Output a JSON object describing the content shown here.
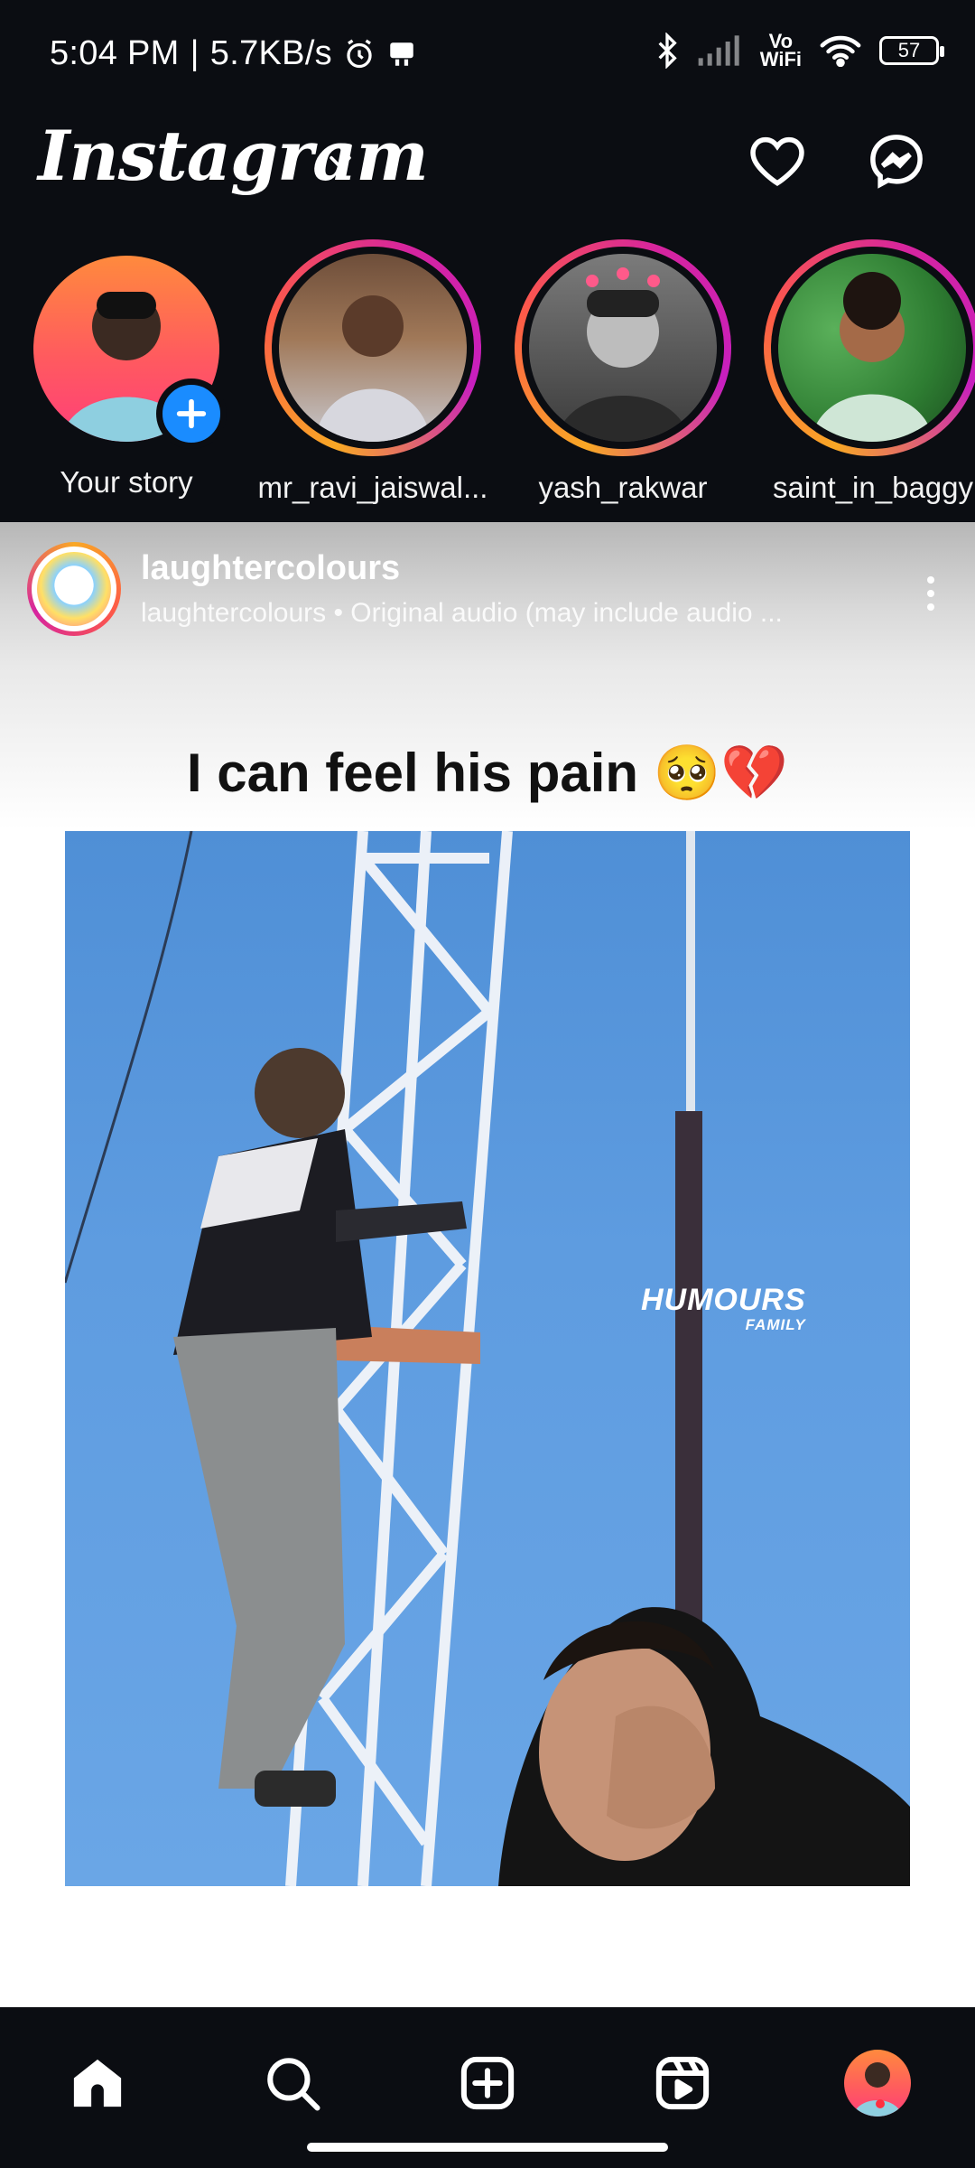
{
  "status_bar": {
    "time": "5:04 PM",
    "separator": "|",
    "network_speed": "5.7KB/s",
    "vowifi_top": "Vo",
    "vowifi_bottom": "WiFi",
    "battery": "57"
  },
  "header": {
    "logo": "Instagram"
  },
  "stories": [
    {
      "label": "Your story"
    },
    {
      "label": "mr_ravi_jaiswal..."
    },
    {
      "label": "yash_rakwar"
    },
    {
      "label": "saint_in_baggy"
    }
  ],
  "post": {
    "username": "laughtercolours",
    "subtitle": "laughtercolours • Original audio (may include audio ...",
    "caption_overlay": "I can feel his pain 🥺💔",
    "watermark_line1": "HUMOURS",
    "watermark_line2": "FAMILY"
  },
  "colors": {
    "background": "#0b0d12",
    "add_badge": "#1a8cff",
    "notification_dot": "#ff3040",
    "story_ring": [
      "#f9a825",
      "#fd5949",
      "#d6249f"
    ]
  },
  "icons": {
    "status": [
      "alarm-icon",
      "notification-icon",
      "bluetooth-icon",
      "signal-icon",
      "wifi-icon",
      "battery-icon"
    ],
    "header": [
      "heart-icon",
      "messenger-icon"
    ],
    "nav": [
      "home-icon",
      "search-icon",
      "create-icon",
      "reels-icon",
      "profile-avatar"
    ]
  }
}
